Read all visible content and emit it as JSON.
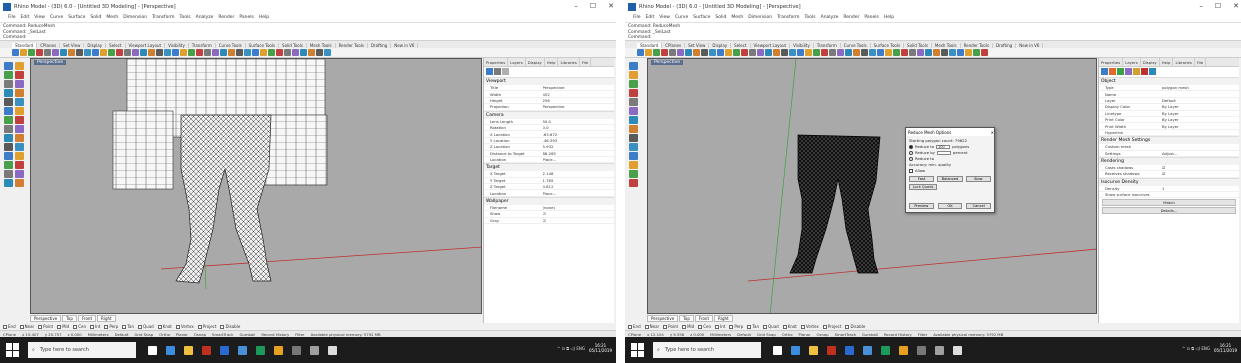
{
  "left": {
    "window_title": "Rhino Model - (3D) 6.0 - [Untitled 3D Modeling] - [Perspective]",
    "window_controls": [
      "–",
      "☐",
      "✕"
    ],
    "menu": [
      "File",
      "Edit",
      "View",
      "Curve",
      "Surface",
      "Solid",
      "Mesh",
      "Dimension",
      "Transform",
      "Tools",
      "Analyze",
      "Render",
      "Panels",
      "Help"
    ],
    "command_history": [
      "Command: ReduceMesh",
      "Command: _SelLast",
      "Command:"
    ],
    "tabs": [
      "Standard",
      "CPlanes",
      "Set View",
      "Display",
      "Select",
      "Viewport Layout",
      "Visibility",
      "Transform",
      "Curve Tools",
      "Surface Tools",
      "Solid Tools",
      "Mesh Tools",
      "Render Tools",
      "Drafting",
      "New in V6"
    ],
    "viewport_label": "Perspective",
    "viewport_tabs": [
      "Perspective",
      "Top",
      "Front",
      "Right"
    ],
    "props_tabs": [
      "Properties",
      "Layers",
      "Display",
      "Help",
      "Libraries",
      "File"
    ],
    "sections": {
      "viewport": {
        "title": "Viewport",
        "rows": [
          {
            "k": "Title",
            "v": "Perspective"
          },
          {
            "k": "Width",
            "v": "452"
          },
          {
            "k": "Height",
            "v": "256"
          },
          {
            "k": "Projection",
            "v": "Perspective"
          }
        ]
      },
      "camera": {
        "title": "Camera",
        "rows": [
          {
            "k": "Lens Length",
            "v": "50.0"
          },
          {
            "k": "Rotation",
            "v": "0.0"
          },
          {
            "k": "X Location",
            "v": "-63.672"
          },
          {
            "k": "Y Location",
            "v": "-46.393"
          },
          {
            "k": "Z Location",
            "v": "5.932"
          },
          {
            "k": "Distance to Target",
            "v": "88.265"
          },
          {
            "k": "Location",
            "v": "Place..."
          }
        ]
      },
      "target": {
        "title": "Target",
        "rows": [
          {
            "k": "X Target",
            "v": "2.148"
          },
          {
            "k": "Y Target",
            "v": "1.765"
          },
          {
            "k": "Z Target",
            "v": "4.812"
          },
          {
            "k": "Location",
            "v": "Place..."
          }
        ]
      },
      "wallpaper": {
        "title": "Wallpaper",
        "rows": [
          {
            "k": "Filename",
            "v": "(none)"
          },
          {
            "k": "Show",
            "v": "☑"
          },
          {
            "k": "Gray",
            "v": "☑"
          }
        ]
      }
    },
    "osnap": [
      "End",
      "Near",
      "Point",
      "Mid",
      "Cen",
      "Int",
      "Perp",
      "Tan",
      "Quad",
      "Knot",
      "Vertex",
      "Project",
      "Disable"
    ],
    "status": [
      "CPlane",
      "x 15.407",
      "y 25.757",
      "z 0.000",
      "Millimeters",
      "Default",
      "Grid Snap",
      "Ortho",
      "Planar",
      "Osnap",
      "SmartTrack",
      "Gumball",
      "Record History",
      "Filter",
      "Available physical memory: 5792 MB"
    ]
  },
  "right": {
    "window_title": "Rhino Model - (3D) 6.0 - [Untitled 3D Modeling] - [Perspective]",
    "window_controls": [
      "–",
      "☐",
      "✕"
    ],
    "menu": [
      "File",
      "Edit",
      "View",
      "Curve",
      "Surface",
      "Solid",
      "Mesh",
      "Dimension",
      "Transform",
      "Tools",
      "Analyze",
      "Render",
      "Panels",
      "Help"
    ],
    "command_history": [
      "Command: ReduceMesh",
      "Command: _SelLast",
      "Command:"
    ],
    "tabs": [
      "Standard",
      "CPlanes",
      "Set View",
      "Display",
      "Select",
      "Viewport Layout",
      "Visibility",
      "Transform",
      "Curve Tools",
      "Surface Tools",
      "Solid Tools",
      "Mesh Tools",
      "Render Tools",
      "Drafting",
      "New in V6"
    ],
    "viewport_label": "Perspective",
    "viewport_tabs": [
      "Perspective",
      "Top",
      "Front",
      "Right"
    ],
    "props_tabs": [
      "Properties",
      "Layers",
      "Display",
      "Help",
      "Libraries",
      "File"
    ],
    "sections": {
      "object": {
        "title": "Object",
        "rows": [
          {
            "k": "Type",
            "v": "polygon mesh"
          },
          {
            "k": "Name",
            "v": ""
          },
          {
            "k": "Layer",
            "v": "Default"
          },
          {
            "k": "Display Color",
            "v": "By Layer"
          },
          {
            "k": "Linetype",
            "v": "By Layer"
          },
          {
            "k": "Print Color",
            "v": "By Layer"
          },
          {
            "k": "Print Width",
            "v": "By Layer"
          },
          {
            "k": "Hyperlink",
            "v": ""
          }
        ]
      },
      "render_mesh": {
        "title": "Render Mesh Settings",
        "rows": [
          {
            "k": "Custom mesh",
            "v": ""
          },
          {
            "k": "Settings",
            "v": "Adjust..."
          }
        ]
      },
      "rendering": {
        "title": "Rendering",
        "rows": [
          {
            "k": "Casts shadows",
            "v": "☑"
          },
          {
            "k": "Receives shadows",
            "v": "☑"
          }
        ]
      },
      "curvature": {
        "title": "Isocurve Density",
        "rows": [
          {
            "k": "Density",
            "v": "1"
          },
          {
            "k": "Show surface isocurves",
            "v": ""
          }
        ]
      }
    },
    "buttons": [
      "Match",
      "Details..."
    ],
    "dialog": {
      "title": "Reduce Mesh Options",
      "line1": "Starting polygon count: 79822",
      "reduce_to_label": "Reduce to",
      "reduce_to_value": "100",
      "reduce_to_unit": "polygons",
      "reduce_by_label": "Reduce by",
      "reduce_by_unit": "percent",
      "reduce_count_label": "Reduce to",
      "accuracy_label": "Accuracy: min. quality",
      "normalize_label": "Allow",
      "btn_row": [
        "Fast",
        "Balanced",
        "Slow"
      ],
      "lock_btn": "Lock Quads",
      "footer": [
        "Preview",
        "OK",
        "Cancel"
      ],
      "close": "✕"
    },
    "osnap": [
      "End",
      "Near",
      "Point",
      "Mid",
      "Cen",
      "Int",
      "Perp",
      "Tan",
      "Quad",
      "Knot",
      "Vertex",
      "Project",
      "Disable"
    ],
    "status": [
      "CPlane",
      "x 12.104",
      "y 9.358",
      "z 0.000",
      "Millimeters",
      "Default",
      "Grid Snap",
      "Ortho",
      "Planar",
      "Osnap",
      "SmartTrack",
      "Gumball",
      "Record History",
      "Filter",
      "Available physical memory: 5792 MB"
    ]
  },
  "taskbar": {
    "search_placeholder": "Type here to search",
    "tray": "^ ⊡ ⧉ ◁) ENG",
    "time": "16:21",
    "date": "05/11/2019"
  },
  "colors": {
    "viewport_bg": "#a9a9a9",
    "x_axis": "#c03030",
    "y_axis": "#30a030",
    "taskbar_bg": "#1c1c1c",
    "accent": "#1e5fa8"
  }
}
